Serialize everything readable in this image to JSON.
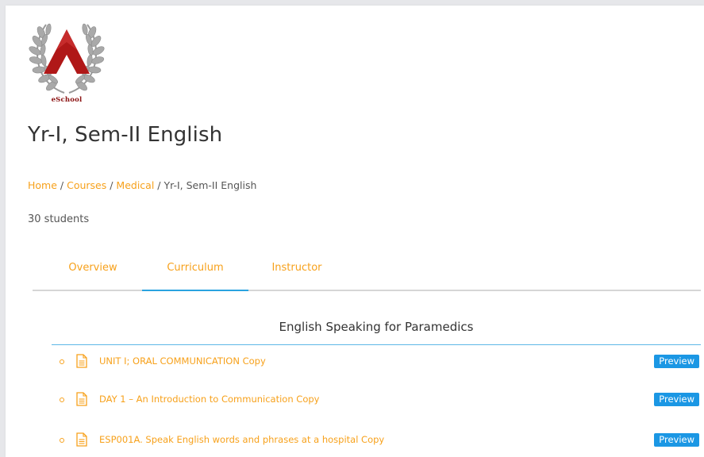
{
  "logo": {
    "text": "eSchool",
    "colors": {
      "laurel": "#a9a9a9",
      "chevron": "#b01818",
      "text": "#8a1010"
    }
  },
  "course": {
    "title": "Yr-I, Sem-II English",
    "students": "30 students"
  },
  "breadcrumb": {
    "home": "Home",
    "courses": "Courses",
    "category": "Medical",
    "current": "Yr-I, Sem-II English",
    "separator": "/"
  },
  "tabs": [
    {
      "label": "Overview",
      "active": false
    },
    {
      "label": "Curriculum",
      "active": true
    },
    {
      "label": "Instructor",
      "active": false
    }
  ],
  "curriculum": {
    "section_title": "English Speaking for Paramedics",
    "lessons": [
      {
        "title": "UNIT I; ORAL COMMUNICATION Copy",
        "preview_label": "Preview",
        "icon": "document-icon"
      },
      {
        "title": "DAY 1 – An Introduction to Communication Copy",
        "preview_label": "Preview",
        "icon": "document-icon"
      },
      {
        "title": "ESP001A. Speak English words and phrases at a hospital Copy",
        "preview_label": "Preview",
        "icon": "document-icon"
      }
    ]
  },
  "colors": {
    "accent_link": "#f7a11b",
    "active_tab_underline": "#2aa3e0",
    "preview_button": "#1b97e4",
    "background": "#e6e7ea"
  }
}
